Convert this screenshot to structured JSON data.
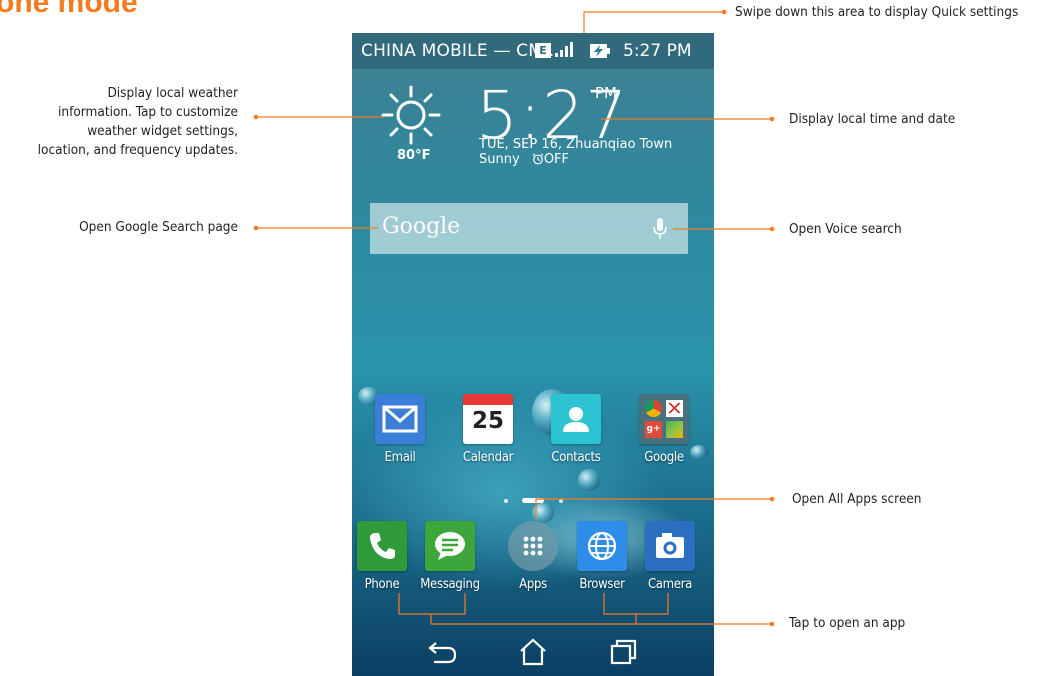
{
  "page_heading": "one mode",
  "status_bar": {
    "carrier": "CHINA  MOBILE — CM...",
    "network_badge": "E",
    "time": "5:27 PM"
  },
  "weather_widget": {
    "temperature": "80°F",
    "time": "5:27",
    "ampm": "PM",
    "date_location": "TUE, SEP 16, Zhuanqiao Town",
    "condition": "Sunny",
    "alarm": "OFF"
  },
  "search_bar": {
    "logo": "Google"
  },
  "calendar_day": "25",
  "apps_row": [
    {
      "label": "Email",
      "icon": "email-icon",
      "color": "#3a7ed8"
    },
    {
      "label": "Calendar",
      "icon": "calendar-icon",
      "color": "#ffffff"
    },
    {
      "label": "Contacts",
      "icon": "contacts-icon",
      "color": "#2cc3d3"
    },
    {
      "label": "Google",
      "icon": "google-folder-icon",
      "color": "#4c6f78"
    }
  ],
  "dock": [
    {
      "label": "Phone",
      "icon": "phone-icon",
      "color": "#2e9a3a"
    },
    {
      "label": "Messaging",
      "icon": "messaging-icon",
      "color": "#3ca63a"
    },
    {
      "label": "Apps",
      "icon": "all-apps-icon",
      "color": "#6f9aa8"
    },
    {
      "label": "Browser",
      "icon": "globe-icon",
      "color": "#2d8de8"
    },
    {
      "label": "Camera",
      "icon": "camera-icon",
      "color": "#2a6fc0"
    }
  ],
  "nav": {
    "back": "back-icon",
    "home": "home-icon",
    "recents": "recent-apps-icon"
  },
  "callouts": {
    "quick_settings": "Swipe down this area to display Quick settings",
    "weather_lines": [
      "Display local weather",
      "information. Tap to customize",
      "weather widget settings,",
      "location, and frequency updates."
    ],
    "time_date": "Display local time and date",
    "google_search": "Open Google Search page",
    "voice_search": "Open Voice search",
    "all_apps": "Open All Apps screen",
    "open_app": "Tap to open an app"
  },
  "colors": {
    "accent_orange": "#f47b20",
    "callout_text": "#231f20"
  }
}
